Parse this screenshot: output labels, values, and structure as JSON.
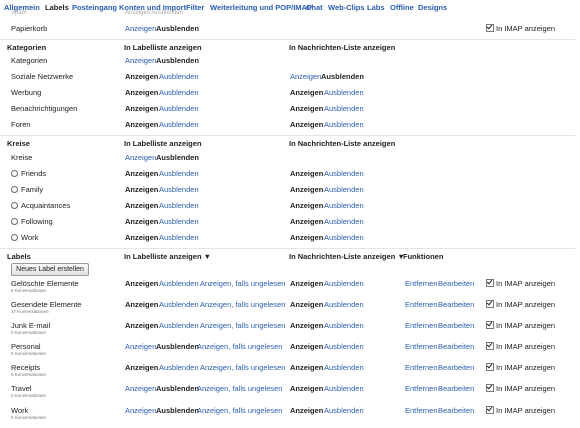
{
  "tabs": [
    "Allgemein",
    "Labels",
    "Posteingang",
    "Konten und Import",
    "Filter",
    "Weiterleitung und POP/IMAP",
    "Chat",
    "Web-Clips",
    "Labs",
    "Offline",
    "Designs"
  ],
  "active_tab": "Labels",
  "common": {
    "show": "Anzeigen",
    "hide": "Ausblenden",
    "show_if_unread": "Anzeigen, falls ungelesen",
    "remove": "Entfernen",
    "edit": "Bearbeiten",
    "imap": "In IMAP anzeigen"
  },
  "top_row": {
    "name": "Papierkorb"
  },
  "categories": {
    "title": "Kategorien",
    "col1": "In Labelliste anzeigen",
    "col2": "In Nachrichten-Liste anzeigen",
    "rows": [
      {
        "name": "Kategorien",
        "list": "hide",
        "msg": null
      },
      {
        "name": "Soziale Netzwerke",
        "list": "show",
        "msg": "hide"
      },
      {
        "name": "Werbung",
        "list": "show",
        "msg": "show"
      },
      {
        "name": "Benachrichtigungen",
        "list": "show",
        "msg": "show"
      },
      {
        "name": "Foren",
        "list": "show",
        "msg": "show"
      }
    ]
  },
  "circles": {
    "title": "Kreise",
    "col1": "In Labelliste anzeigen",
    "col2": "In Nachrichten-Liste anzeigen",
    "rows": [
      {
        "name": "Kreise",
        "radio": false,
        "list": "hide",
        "msg": null
      },
      {
        "name": "Friends",
        "radio": true,
        "list": "show",
        "msg": "show"
      },
      {
        "name": "Family",
        "radio": true,
        "list": "show",
        "msg": "show"
      },
      {
        "name": "Acquaintances",
        "radio": true,
        "list": "show",
        "msg": "show"
      },
      {
        "name": "Following",
        "radio": true,
        "list": "show",
        "msg": "show"
      },
      {
        "name": "Work",
        "radio": true,
        "list": "show",
        "msg": "show"
      }
    ]
  },
  "labels": {
    "title": "Labels",
    "col1": "In Labelliste anzeigen ▼",
    "col2": "In Nachrichten-Liste anzeigen ▼",
    "col3": "Funktionen",
    "new_button": "Neues Label erstellen",
    "rows": [
      {
        "name": "Gelöschte Elemente",
        "count": "8 Konversationen",
        "list": "show",
        "msg": "show"
      },
      {
        "name": "Gesendete Elemente",
        "count": "17 Konversationen",
        "list": "show",
        "msg": "show"
      },
      {
        "name": "Junk E-mail",
        "count": "0 Konversationen",
        "list": "show",
        "msg": "show"
      },
      {
        "name": "Personal",
        "count": "0 Konversationen",
        "list": "hide",
        "msg": "show"
      },
      {
        "name": "Receipts",
        "count": "0 Konversationen",
        "list": "show",
        "msg": "show"
      },
      {
        "name": "Travel",
        "count": "0 Konversationen",
        "list": "hide",
        "msg": "show"
      },
      {
        "name": "Work",
        "count": "0 Konversationen",
        "list": "hide",
        "msg": "show"
      }
    ]
  }
}
